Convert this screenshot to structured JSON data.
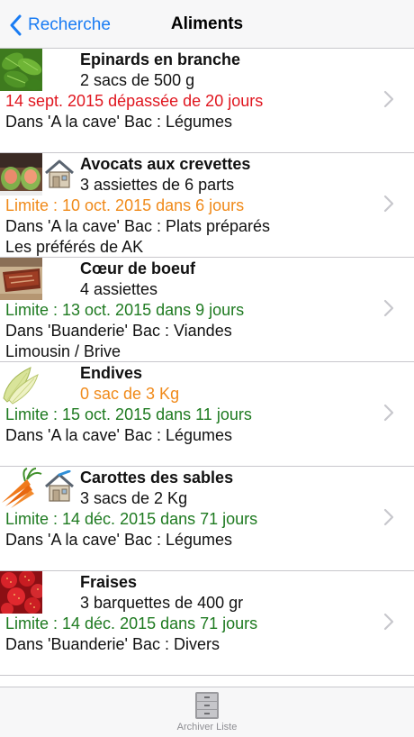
{
  "navbar": {
    "back_label": "Recherche",
    "title": "Aliments"
  },
  "items": [
    {
      "name": "Epinards en branche",
      "quantity": "2 sacs de 500 g",
      "date": "14 sept. 2015 dépassée de 20 jours",
      "location": "Dans 'A la cave' Bac : Légumes",
      "note": ""
    },
    {
      "name": "Avocats aux crevettes",
      "quantity": "3 assiettes de 6 parts",
      "date": "Limite : 10 oct. 2015 dans 6 jours",
      "location": "Dans 'A la cave' Bac : Plats préparés",
      "note": "Les préférés de AK"
    },
    {
      "name": "Cœur de boeuf",
      "quantity": "4 assiettes",
      "date": "Limite : 13 oct. 2015 dans 9 jours",
      "location": "Dans 'Buanderie' Bac : Viandes",
      "note": "Limousin / Brive"
    },
    {
      "name": "Endives",
      "quantity": "0 sac de 3 Kg",
      "date": "Limite : 15 oct. 2015 dans 11 jours",
      "location": "Dans 'A la cave' Bac : Légumes",
      "note": ""
    },
    {
      "name": "Carottes des sables",
      "quantity": "3 sacs de 2 Kg",
      "date": "Limite : 14 déc. 2015 dans 71 jours",
      "location": "Dans 'A la cave' Bac : Légumes",
      "note": ""
    },
    {
      "name": "Fraises",
      "quantity": "3 barquettes de 400 gr",
      "date": "Limite : 14 déc. 2015 dans 71 jours",
      "location": "Dans 'Buanderie' Bac : Divers",
      "note": ""
    }
  ],
  "colors": {
    "accent": "#1a7cf3",
    "expired": "#e0161f",
    "warning": "#f08a1a",
    "ok": "#1e7a20"
  },
  "tabbar": {
    "archive_label": "Archiver Liste"
  }
}
